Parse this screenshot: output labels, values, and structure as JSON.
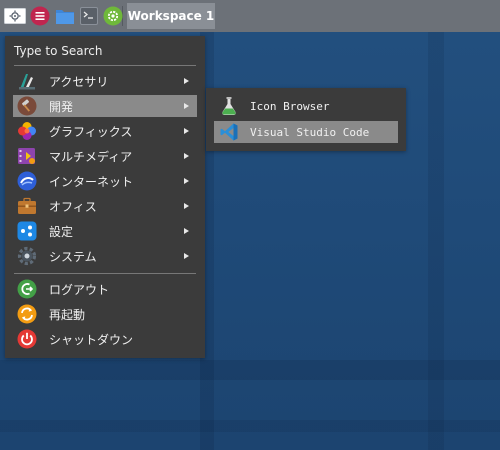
{
  "taskbar": {
    "workspace_label": "Workspace 1",
    "buttons": [
      {
        "name": "app-menu",
        "icon": "settings-panel-icon"
      },
      {
        "name": "main-menu",
        "icon": "hamburger-menu-icon"
      },
      {
        "name": "file-manager",
        "icon": "folder-icon"
      },
      {
        "name": "terminal",
        "icon": "terminal-icon"
      },
      {
        "name": "settings",
        "icon": "gear-icon"
      }
    ]
  },
  "menu": {
    "search_placeholder": "Type to Search",
    "items": [
      {
        "label": "アクセサリ",
        "icon": "accessories-icon",
        "submenu": true
      },
      {
        "label": "開発",
        "icon": "development-icon",
        "submenu": true,
        "active": true
      },
      {
        "label": "グラフィックス",
        "icon": "graphics-icon",
        "submenu": true
      },
      {
        "label": "マルチメディア",
        "icon": "multimedia-icon",
        "submenu": true
      },
      {
        "label": "インターネット",
        "icon": "internet-icon",
        "submenu": true
      },
      {
        "label": "オフィス",
        "icon": "office-icon",
        "submenu": true
      },
      {
        "label": "設定",
        "icon": "settings-icon",
        "submenu": true
      },
      {
        "label": "システム",
        "icon": "system-icon",
        "submenu": true
      }
    ],
    "session": [
      {
        "label": "ログアウト",
        "icon": "logout-icon"
      },
      {
        "label": "再起動",
        "icon": "restart-icon"
      },
      {
        "label": "シャットダウン",
        "icon": "shutdown-icon"
      }
    ]
  },
  "submenu": {
    "items": [
      {
        "label": "Icon Browser",
        "icon": "flask-icon"
      },
      {
        "label": "Visual Studio Code",
        "icon": "vscode-icon",
        "active": true
      }
    ]
  },
  "colors": {
    "menu_bg": "#3b3b3b",
    "menu_highlight": "#8a8a8a",
    "taskbar_bg": "#6c7178",
    "desktop_bg": "#1f4a78"
  }
}
